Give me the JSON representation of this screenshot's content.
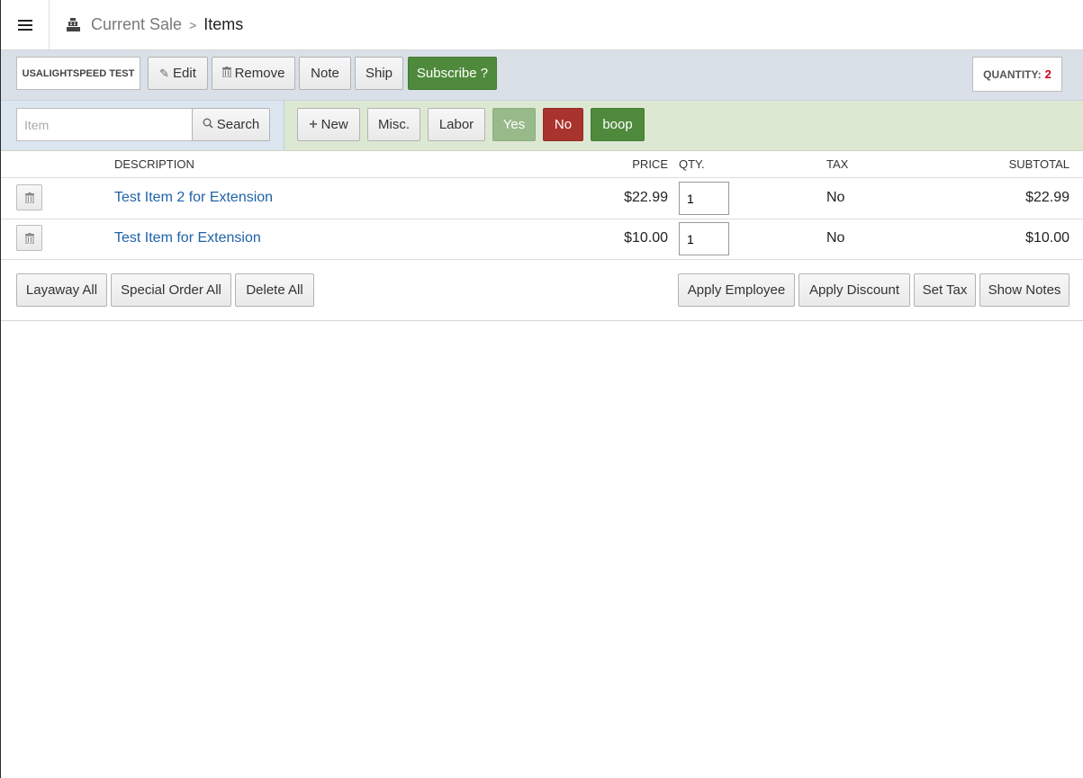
{
  "header": {
    "breadcrumb_parent": "Current Sale",
    "breadcrumb_separator": ">",
    "breadcrumb_current": "Items",
    "menu_icon": "hamburger-icon",
    "register_icon": "cash-register-icon"
  },
  "toolbar": {
    "customer": "USALIGHTSPEED TEST",
    "edit_label": "Edit",
    "remove_label": "Remove",
    "note_label": "Note",
    "ship_label": "Ship",
    "subscribe_label": "Subscribe ?",
    "quantity_label": "QUANTITY:",
    "quantity_value": "2"
  },
  "item_bar": {
    "search_placeholder": "Item",
    "search_label": "Search",
    "new_label": "New",
    "misc_label": "Misc.",
    "labor_label": "Labor",
    "yes_label": "Yes",
    "no_label": "No",
    "boop_label": "boop"
  },
  "table": {
    "columns": {
      "description": "DESCRIPTION",
      "price": "PRICE",
      "qty": "QTY.",
      "tax": "TAX",
      "subtotal": "SUBTOTAL"
    },
    "rows": [
      {
        "description": "Test Item 2 for Extension",
        "price": "$22.99",
        "qty": "1",
        "tax": "No",
        "subtotal": "$22.99"
      },
      {
        "description": "Test Item for Extension",
        "price": "$10.00",
        "qty": "1",
        "tax": "No",
        "subtotal": "$10.00"
      }
    ]
  },
  "actions": {
    "layaway_all": "Layaway All",
    "special_order_all": "Special Order All",
    "delete_all": "Delete All",
    "apply_employee": "Apply Employee",
    "apply_discount": "Apply Discount",
    "set_tax": "Set Tax",
    "show_notes": "Show Notes"
  },
  "colors": {
    "green": "#4f8a3c",
    "yes_green_light": "#98b98a",
    "no_red": "#a9342d",
    "link_blue": "#1f62a8",
    "quantity_red": "#d0021b"
  }
}
